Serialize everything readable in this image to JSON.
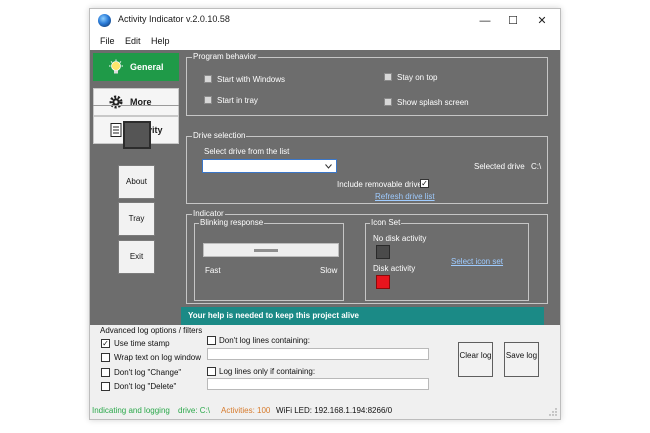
{
  "window": {
    "title": "Activity Indicator v.2.0.10.58",
    "minimize": "—",
    "maximize": "☐",
    "close": "✕"
  },
  "menu": [
    "File",
    "Edit",
    "Help"
  ],
  "nav": [
    {
      "label": "General",
      "active": true
    },
    {
      "label": "More",
      "active": false
    },
    {
      "label": "Activity",
      "active": false
    }
  ],
  "side_buttons": [
    "About",
    "Tray",
    "Exit"
  ],
  "program_behavior": {
    "title": "Program behavior",
    "options": [
      "Start with Windows",
      "Start in tray",
      "Stay on top",
      "Show splash screen"
    ]
  },
  "drive_selection": {
    "title": "Drive selection",
    "select_label": "Select drive from the list",
    "combo_value": "",
    "include_removable": "Include removable drives",
    "include_removable_checked": true,
    "refresh_link": "Refresh drive list",
    "selected_label": "Selected drive",
    "selected_value": "C:\\"
  },
  "indicator": {
    "title": "Indicator",
    "blinking_title": "Blinking response",
    "fast": "Fast",
    "slow": "Slow",
    "icon_set_title": "Icon Set",
    "no_activity": "No disk activity",
    "disk_activity": "Disk activity",
    "select_icon_link": "Select icon set",
    "colors": {
      "no_activity": "#4a4a4a",
      "disk_activity": "#e8141d"
    }
  },
  "banner": "Your help is needed to keep this project alive",
  "log_options": {
    "title": "Advanced log options / filters",
    "checks": [
      {
        "label": "Use time stamp",
        "checked": true
      },
      {
        "label": "Wrap text on log window",
        "checked": false
      },
      {
        "label": "Don't log \"Change\"",
        "checked": false
      },
      {
        "label": "Don't log \"Delete\"",
        "checked": false
      }
    ],
    "filter_contains": "Don't log lines containing:",
    "filter_only": "Log lines only if containing:",
    "clear_button": "Clear log",
    "save_button": "Save log"
  },
  "status": {
    "mode": "Indicating and logging",
    "drive": "drive: C:\\",
    "activities": "Activities: 100",
    "wifi": "WiFi LED: 192.168.1.194:8266/0"
  },
  "colors": {
    "accent_green": "#1f9a48",
    "panel_gray": "#6d6d6d",
    "banner_teal": "#1b8a86",
    "status_orange": "#d77a2b"
  }
}
